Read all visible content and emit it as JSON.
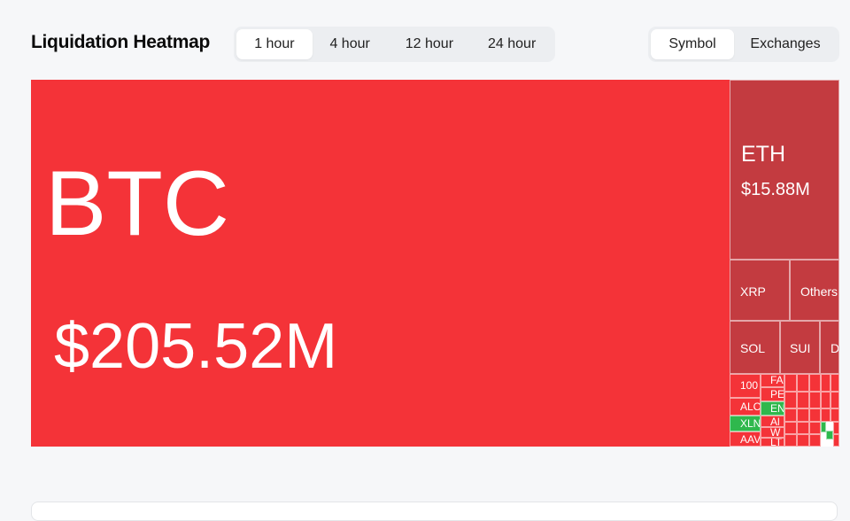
{
  "header": {
    "title": "Liquidation Heatmap"
  },
  "time_tabs": [
    {
      "label": "1 hour",
      "active": true
    },
    {
      "label": "4 hour",
      "active": false
    },
    {
      "label": "12 hour",
      "active": false
    },
    {
      "label": "24 hour",
      "active": false
    }
  ],
  "view_tabs": [
    {
      "label": "Symbol",
      "active": true
    },
    {
      "label": "Exchanges",
      "active": false
    }
  ],
  "colors": {
    "red": "#f43338",
    "dark_red": "#c33b40",
    "green": "#2fb84d"
  },
  "heatmap": {
    "btc": {
      "symbol": "BTC",
      "value": "$205.52M"
    },
    "eth": {
      "symbol": "ETH",
      "value": "$15.88M"
    },
    "xrp": {
      "symbol": "XRP"
    },
    "others": {
      "symbol": "Others"
    },
    "sol": {
      "symbol": "SOL"
    },
    "sui": {
      "symbol": "SUI"
    },
    "d": {
      "symbol": "D"
    },
    "c100": {
      "symbol": "100"
    },
    "fa": {
      "symbol": "FA"
    },
    "pe": {
      "symbol": "PE"
    },
    "alc": {
      "symbol": "ALC"
    },
    "en": {
      "symbol": "EN"
    },
    "xln": {
      "symbol": "XLN"
    },
    "al": {
      "symbol": "Al"
    },
    "w": {
      "symbol": "W"
    },
    "aav": {
      "symbol": "AAV"
    },
    "lt": {
      "symbol": "LT"
    }
  }
}
